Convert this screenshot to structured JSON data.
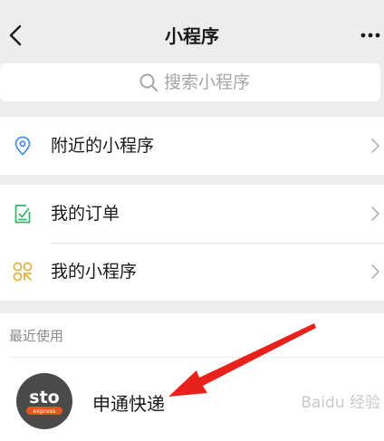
{
  "header": {
    "title": "小程序",
    "back_icon": "chevron-left-icon",
    "more_icon": "more-dots-icon"
  },
  "search": {
    "placeholder": "搜索小程序",
    "icon": "search-icon"
  },
  "menu": {
    "nearby": {
      "label": "附近的小程序",
      "icon": "location-pin-icon",
      "color": "#4a90e2"
    },
    "orders": {
      "label": "我的订单",
      "icon": "order-check-icon",
      "color": "#3db36b"
    },
    "mine": {
      "label": "我的小程序",
      "icon": "mini-program-icon",
      "color": "#e2b340"
    }
  },
  "recent": {
    "section_title": "最近使用",
    "items": [
      {
        "name": "申通快递",
        "logo_text": "sto",
        "logo_subtext": "express",
        "logo_color": "#4a4a4a",
        "logo_accent": "#e8541e"
      }
    ]
  },
  "annotation": {
    "arrow_color": "#e8211c"
  },
  "watermark": {
    "text": "Baidu 经验"
  }
}
